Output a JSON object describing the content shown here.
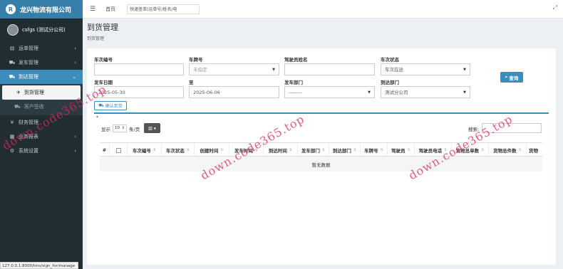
{
  "brand": {
    "title": "龙兴物流有限公司",
    "logo_glyph": "R"
  },
  "user": {
    "name": "csfgs (测试分公司)"
  },
  "sidebar": {
    "items": [
      {
        "label": "运单管理",
        "icon": "clipboard-icon",
        "glyph": "▤",
        "chevron": "‹"
      },
      {
        "label": "发车管理",
        "icon": "truck-icon",
        "glyph": "⛟",
        "chevron": "‹"
      },
      {
        "label": "到达管理",
        "icon": "truck-arrive-icon",
        "glyph": "⛟",
        "chevron": "⌄"
      },
      {
        "label": "财务管理",
        "icon": "yen-icon",
        "glyph": "¥",
        "chevron": ""
      },
      {
        "label": "业务报表",
        "icon": "report-icon",
        "glyph": "▦",
        "chevron": "‹"
      },
      {
        "label": "系统设置",
        "icon": "gear-icon",
        "glyph": "⚙",
        "chevron": "‹"
      }
    ],
    "subitems": [
      {
        "label": "到货管理",
        "icon": "plane-land-icon",
        "glyph": "✈"
      },
      {
        "label": "客户签收",
        "icon": "truck-icon",
        "glyph": "⛟"
      }
    ]
  },
  "statusbar": {
    "url": "127.0.0.1:8000/tms/sign_for/manage"
  },
  "topbar": {
    "home": "首页",
    "search_text": "快速查单(运单号/姓名/电"
  },
  "content": {
    "title": "到货管理",
    "breadcrumb": "到货管理"
  },
  "filters": {
    "vehicle_no_label": "车次编号",
    "vehicle_no_value": "",
    "plate_label": "车牌号",
    "plate_value": "未指定",
    "driver_label": "驾驶员姓名",
    "driver_value": "",
    "status_label": "车次状态",
    "status_value": "车次在途",
    "depart_date_label": "发车日期",
    "depart_date_value": "2025-05-30",
    "to_label": "至",
    "to_value": "2025-06-06",
    "depart_dept_label": "发车部门",
    "depart_dept_value": "--------",
    "arrive_dept_label": "到达部门",
    "arrive_dept_value": "测试分公司"
  },
  "buttons": {
    "query": "查询",
    "confirm": "确认到货"
  },
  "table_ctl": {
    "show": "显示",
    "page_size": "10",
    "per_page": "条/页",
    "search": "搜索:"
  },
  "table": {
    "headers": [
      "#",
      "",
      "车次编号",
      "车次状态",
      "创建时间",
      "发车时间",
      "到达时间",
      "发车部门",
      "到达部门",
      "车牌号",
      "驾驶员",
      "驾驶员电话",
      "货物总单数",
      "货物总件数",
      "货物"
    ],
    "empty_text": "暂无数据"
  },
  "watermark": "down.code365.top"
}
